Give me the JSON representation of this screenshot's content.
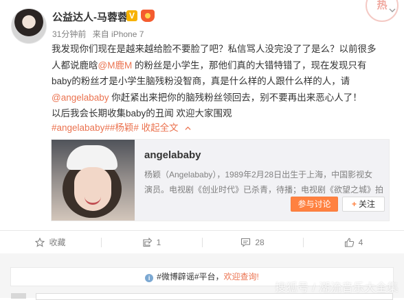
{
  "user": {
    "name": "公益达人-马蓉蓉",
    "verified_icon": "verified-icon",
    "member_icon": "vip-member-icon",
    "post_time": "31分钟前",
    "source": "来自 iPhone 7"
  },
  "corner_stamp": "热",
  "post": {
    "line1": "我发现你们现在是越来越给脸不要脸了吧？私信骂人没完没了了是么？以前很多",
    "line2_before": "人都说鹿晗",
    "mention1": "@M鹿M",
    "line2_after": " 的粉丝是小学生，那他们真的大错特错了，现在发现只有",
    "line3": "baby的粉丝才是小学生脑残粉没智商，真是什么样的人跟什么样的人，请",
    "mention2": "@angelababy",
    "line4_after": " 你赶紧出来把你的脑残粉丝领回去，别不要再出来恶心人了！",
    "line5": "以后我会长期收集baby的丑闻 欢迎大家围观",
    "tag1": "#angelababy#",
    "tag2": "#杨颖#",
    "collapse": "收起全文"
  },
  "card": {
    "title": "angelababy",
    "desc1": "杨颖（Angelababy），1989年2月28日出生于上海，中国影视女",
    "desc2": "演员。电视剧《创业时代》已杀青，待播；电视剧《欲望之城》拍",
    "discuss_button": "参与讨论",
    "follow_button": "关注",
    "follow_icon": "+"
  },
  "actions": {
    "favorite": "收藏",
    "repost": "1",
    "comment": "28",
    "like": "4"
  },
  "rumor": {
    "icon": "i",
    "tag": "#微博辟谣#平台，",
    "link": "欢迎查询!"
  },
  "watermark": "搜狐号 / 潮流音乐大全集",
  "colors": {
    "link": "#eb7350",
    "button": "#ff8140",
    "card_bg": "#f2f2f5",
    "meta": "#808080"
  }
}
